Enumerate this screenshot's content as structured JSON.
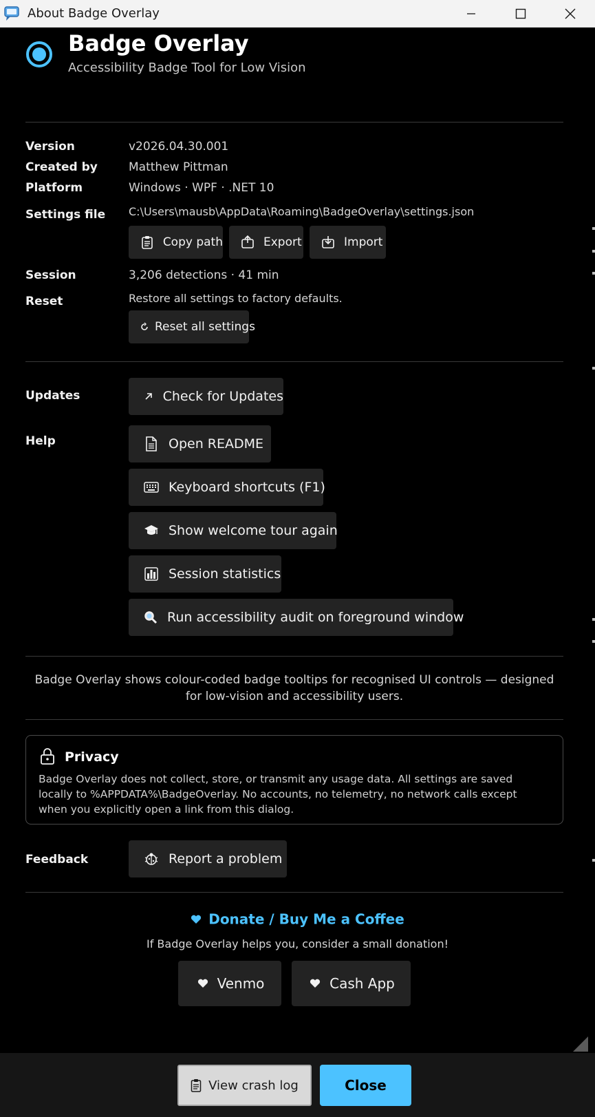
{
  "window": {
    "title": "About Badge Overlay"
  },
  "header": {
    "title": "Badge Overlay",
    "subtitle": "Accessibility Badge Tool for Low Vision"
  },
  "info": {
    "version_label": "Version",
    "version_value": "v2026.04.30.001",
    "created_label": "Created by",
    "created_value": "Matthew Pittman",
    "platform_label": "Platform",
    "platform_value": "Windows · WPF · .NET 10",
    "settings_label": "Settings file",
    "settings_value": "C:\\Users\\mausb\\AppData\\Roaming\\BadgeOverlay\\settings.json",
    "session_label": "Session",
    "session_value": "3,206 detections · 41 min",
    "reset_label": "Reset",
    "reset_desc": "Restore all settings to factory defaults."
  },
  "buttons": {
    "copy_path": "Copy path",
    "export": "Export",
    "import": "Import",
    "reset_all": "Reset all settings"
  },
  "updates": {
    "label": "Updates",
    "check": "Check for Updates"
  },
  "help": {
    "label": "Help",
    "readme": "Open README",
    "shortcuts": "Keyboard shortcuts (F1)",
    "tour": "Show welcome tour again",
    "stats": "Session statistics",
    "audit": "Run accessibility audit on foreground window"
  },
  "description": "Badge Overlay shows colour-coded badge tooltips for recognised UI controls — designed for low-vision and accessibility users.",
  "privacy": {
    "title": "Privacy",
    "body": "Badge Overlay does not collect, store, or transmit any usage data. All settings are saved locally to %APPDATA%\\BadgeOverlay. No accounts, no telemetry, no network calls except when you explicitly open a link from this dialog."
  },
  "feedback": {
    "label": "Feedback",
    "report": "Report a problem"
  },
  "donate": {
    "title": "Donate / Buy Me a Coffee",
    "subtitle": "If Badge Overlay helps you, consider a small donation!",
    "venmo": "Venmo",
    "cashapp": "Cash App"
  },
  "footer": {
    "crash_log": "View crash log",
    "close": "Close"
  },
  "colors": {
    "accent": "#4cc2ff",
    "background": "#000000",
    "button": "#232323"
  }
}
